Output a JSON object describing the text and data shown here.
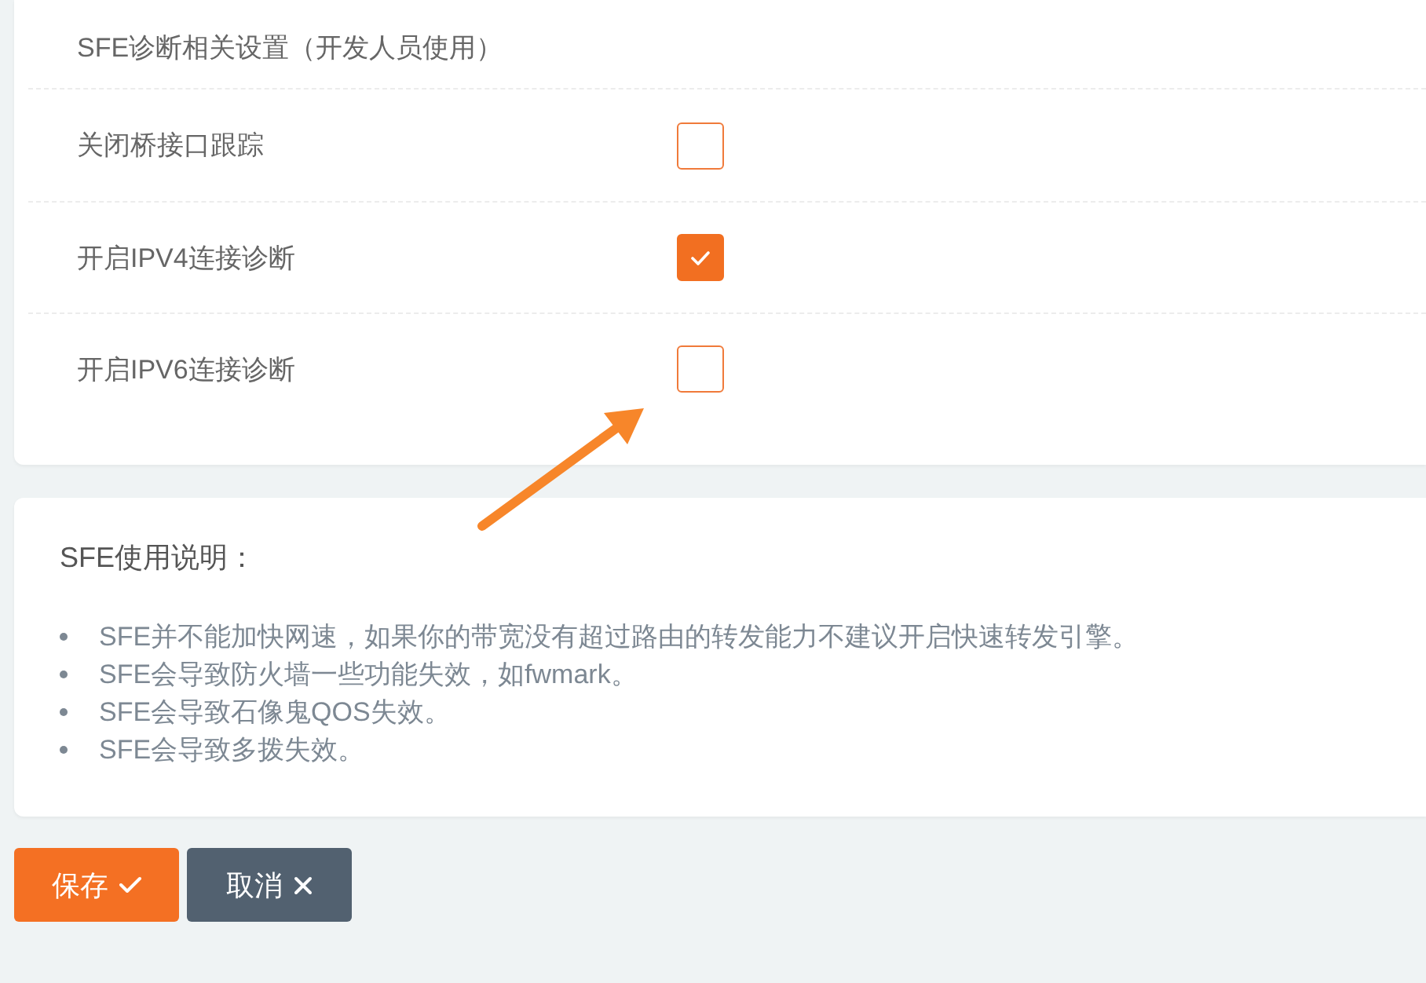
{
  "diagnostics": {
    "title": "SFE诊断相关设置（开发人员使用）",
    "options": [
      {
        "label": "关闭桥接口跟踪",
        "checked": false
      },
      {
        "label": "开启IPV4连接诊断",
        "checked": true
      },
      {
        "label": "开启IPV6连接诊断",
        "checked": false
      }
    ]
  },
  "notes": {
    "title": "SFE使用说明：",
    "items": [
      "SFE并不能加快网速，如果你的带宽没有超过路由的转发能力不建议开启快速转发引擎。",
      "SFE会导致防火墙一些功能失效，如fwmark。",
      "SFE会导致石像鬼QOS失效。",
      "SFE会导致多拨失效。"
    ]
  },
  "buttons": [
    {
      "label": "保存",
      "kind": "save"
    },
    {
      "label": "取消",
      "kind": "cancel"
    }
  ]
}
